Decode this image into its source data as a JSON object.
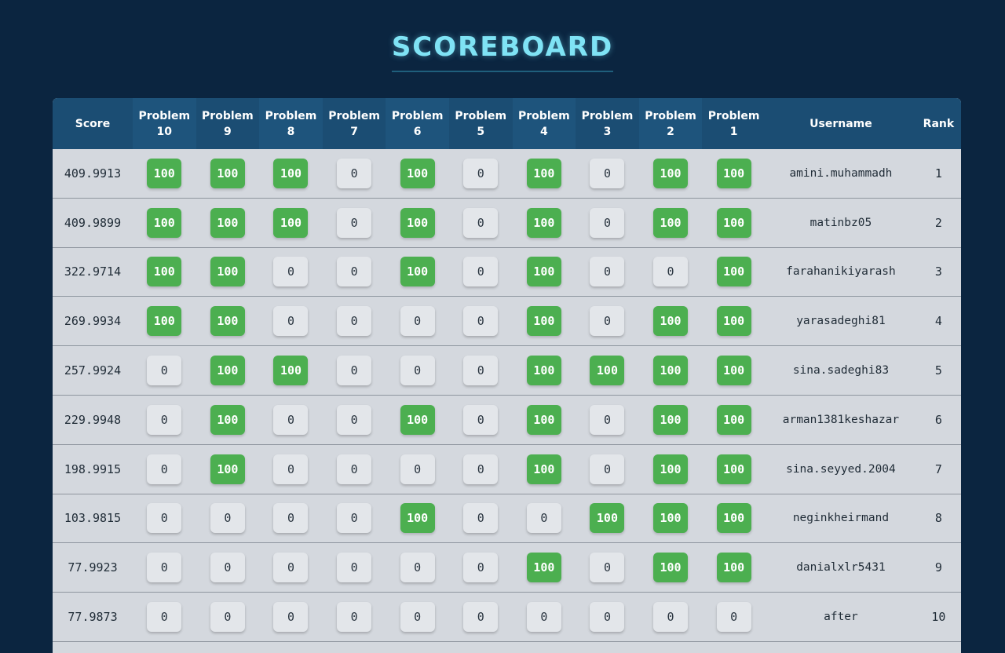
{
  "title": "SCOREBOARD",
  "colors": {
    "background": "#0b2540",
    "header": "#1b4d73",
    "accent": "#7fe3f5",
    "solved": "#4caf50",
    "unsolved": "#e3e6ea"
  },
  "headers": {
    "score": "Score",
    "problems": [
      [
        "Problem",
        "10"
      ],
      [
        "Problem",
        "9"
      ],
      [
        "Problem",
        "8"
      ],
      [
        "Problem",
        "7"
      ],
      [
        "Problem",
        "6"
      ],
      [
        "Problem",
        "5"
      ],
      [
        "Problem",
        "4"
      ],
      [
        "Problem",
        "3"
      ],
      [
        "Problem",
        "2"
      ],
      [
        "Problem",
        "1"
      ]
    ],
    "username": "Username",
    "rank": "Rank"
  },
  "rows": [
    {
      "score": "409.9913",
      "problems": [
        "100",
        "100",
        "100",
        "0",
        "100",
        "0",
        "100",
        "0",
        "100",
        "100"
      ],
      "username": "amini.muhammadh",
      "rank": "1"
    },
    {
      "score": "409.9899",
      "problems": [
        "100",
        "100",
        "100",
        "0",
        "100",
        "0",
        "100",
        "0",
        "100",
        "100"
      ],
      "username": "matinbz05",
      "rank": "2"
    },
    {
      "score": "322.9714",
      "problems": [
        "100",
        "100",
        "0",
        "0",
        "100",
        "0",
        "100",
        "0",
        "0",
        "100"
      ],
      "username": "farahanikiyarash",
      "rank": "3"
    },
    {
      "score": "269.9934",
      "problems": [
        "100",
        "100",
        "0",
        "0",
        "0",
        "0",
        "100",
        "0",
        "100",
        "100"
      ],
      "username": "yarasadeghi81",
      "rank": "4"
    },
    {
      "score": "257.9924",
      "problems": [
        "0",
        "100",
        "100",
        "0",
        "0",
        "0",
        "100",
        "100",
        "100",
        "100"
      ],
      "username": "sina.sadeghi83",
      "rank": "5"
    },
    {
      "score": "229.9948",
      "problems": [
        "0",
        "100",
        "0",
        "0",
        "100",
        "0",
        "100",
        "0",
        "100",
        "100"
      ],
      "username": "arman1381keshazar",
      "rank": "6"
    },
    {
      "score": "198.9915",
      "problems": [
        "0",
        "100",
        "0",
        "0",
        "0",
        "0",
        "100",
        "0",
        "100",
        "100"
      ],
      "username": "sina.seyyed.2004",
      "rank": "7"
    },
    {
      "score": "103.9815",
      "problems": [
        "0",
        "0",
        "0",
        "0",
        "100",
        "0",
        "0",
        "100",
        "100",
        "100"
      ],
      "username": "neginkheirmand",
      "rank": "8"
    },
    {
      "score": "77.9923",
      "problems": [
        "0",
        "0",
        "0",
        "0",
        "0",
        "0",
        "100",
        "0",
        "100",
        "100"
      ],
      "username": "danialxlr5431",
      "rank": "9"
    },
    {
      "score": "77.9873",
      "problems": [
        "0",
        "0",
        "0",
        "0",
        "0",
        "0",
        "0",
        "0",
        "0",
        "0"
      ],
      "username": "after",
      "rank": "10"
    }
  ]
}
